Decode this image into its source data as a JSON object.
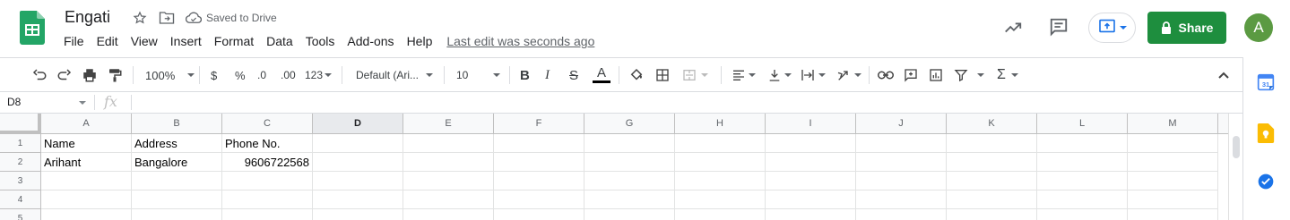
{
  "app": {
    "doc_title": "Engati",
    "saved_status": "Saved to Drive",
    "last_edit": "Last edit was seconds ago",
    "share_label": "Share",
    "avatar_initial": "A",
    "brand_color": "#1e8e3e"
  },
  "menu": [
    "File",
    "Edit",
    "View",
    "Insert",
    "Format",
    "Data",
    "Tools",
    "Add-ons",
    "Help"
  ],
  "toolbar": {
    "zoom": "100%",
    "currency": "$",
    "percent": "%",
    "decrease_decimal": ".0",
    "increase_decimal": ".00",
    "more_formats": "123",
    "font": "Default (Ari...",
    "font_size": "10",
    "bold": "B",
    "italic": "I",
    "strikethrough": "S",
    "text_color": "A",
    "sum": "Σ"
  },
  "formula_bar": {
    "name_box": "D8",
    "fx": "fx",
    "value": ""
  },
  "sheet": {
    "columns": [
      "A",
      "B",
      "C",
      "D",
      "E",
      "F",
      "G",
      "H",
      "I",
      "J",
      "K",
      "L",
      "M"
    ],
    "rows": [
      {
        "num": "1",
        "cells": [
          "Name",
          "Address",
          "Phone No."
        ]
      },
      {
        "num": "2",
        "cells": [
          "Arihant",
          "Bangalore",
          "9606722568"
        ]
      },
      {
        "num": "3",
        "cells": [
          "",
          "",
          ""
        ]
      },
      {
        "num": "4",
        "cells": [
          "",
          "",
          ""
        ]
      },
      {
        "num": "5",
        "cells": [
          "",
          "",
          ""
        ]
      }
    ]
  }
}
